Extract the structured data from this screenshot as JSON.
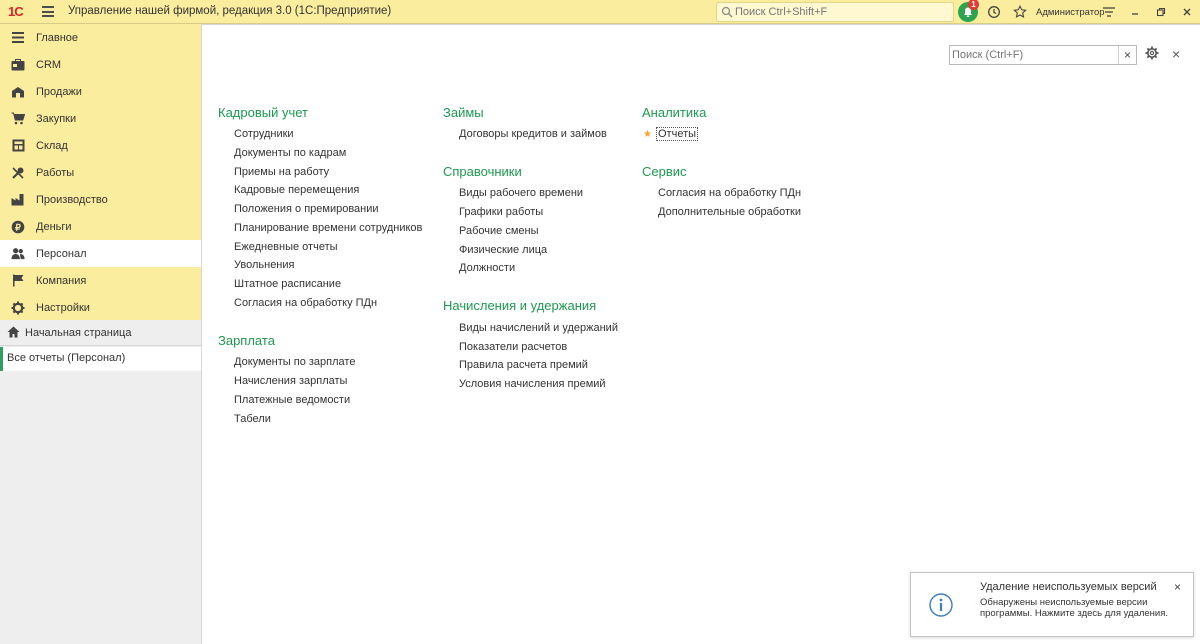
{
  "app": {
    "title": "Управление нашей фирмой, редакция 3.0  (1С:Предприятие)",
    "logo_text": "1С",
    "search_placeholder": "Поиск Ctrl+Shift+F",
    "notification_count": "1",
    "user": "Администратор"
  },
  "sidebar": {
    "items": [
      {
        "label": "Главное",
        "icon": "menu-lines-icon"
      },
      {
        "label": "CRM",
        "icon": "crm-icon"
      },
      {
        "label": "Продажи",
        "icon": "sales-icon"
      },
      {
        "label": "Закупки",
        "icon": "cart-icon"
      },
      {
        "label": "Склад",
        "icon": "warehouse-icon"
      },
      {
        "label": "Работы",
        "icon": "tools-icon"
      },
      {
        "label": "Производство",
        "icon": "factory-icon"
      },
      {
        "label": "Деньги",
        "icon": "money-icon"
      },
      {
        "label": "Персонал",
        "icon": "people-icon"
      },
      {
        "label": "Компания",
        "icon": "flag-icon"
      },
      {
        "label": "Настройки",
        "icon": "gear-icon"
      }
    ],
    "active_index": 8,
    "home": "Начальная страница",
    "open_window": "Все отчеты (Персонал)"
  },
  "form": {
    "search_placeholder": "Поиск (Ctrl+F)",
    "sections": {
      "hr": {
        "title": "Кадровый учет",
        "links": [
          "Сотрудники",
          "Документы по кадрам",
          "Приемы на работу",
          "Кадровые перемещения",
          "Положения о премировании",
          "Планирование времени сотрудников",
          "Ежедневные отчеты",
          "Увольнения",
          "Штатное расписание",
          "Согласия на обработку ПДн"
        ]
      },
      "salary": {
        "title": "Зарплата",
        "links": [
          "Документы по зарплате",
          "Начисления зарплаты",
          "Платежные ведомости",
          "Табели"
        ]
      },
      "loans": {
        "title": "Займы",
        "links": [
          "Договоры кредитов и займов"
        ]
      },
      "refs": {
        "title": "Справочники",
        "links": [
          "Виды рабочего времени",
          "Графики работы",
          "Рабочие смены",
          "Физические лица",
          "Должности"
        ]
      },
      "accruals": {
        "title": "Начисления и удержания",
        "links": [
          "Виды начислений и удержаний",
          "Показатели расчетов",
          "Правила расчета премий",
          "Условия начисления премий"
        ]
      },
      "analytics": {
        "title": "Аналитика",
        "links": [
          "Отчеты"
        ]
      },
      "service": {
        "title": "Сервис",
        "links": [
          "Согласия на обработку ПДн",
          "Дополнительные обработки"
        ]
      }
    }
  },
  "notification": {
    "title": "Удаление неиспользуемых версий",
    "text": "Обнаружены неиспользуемые версии программы. Нажмите здесь для удаления."
  }
}
